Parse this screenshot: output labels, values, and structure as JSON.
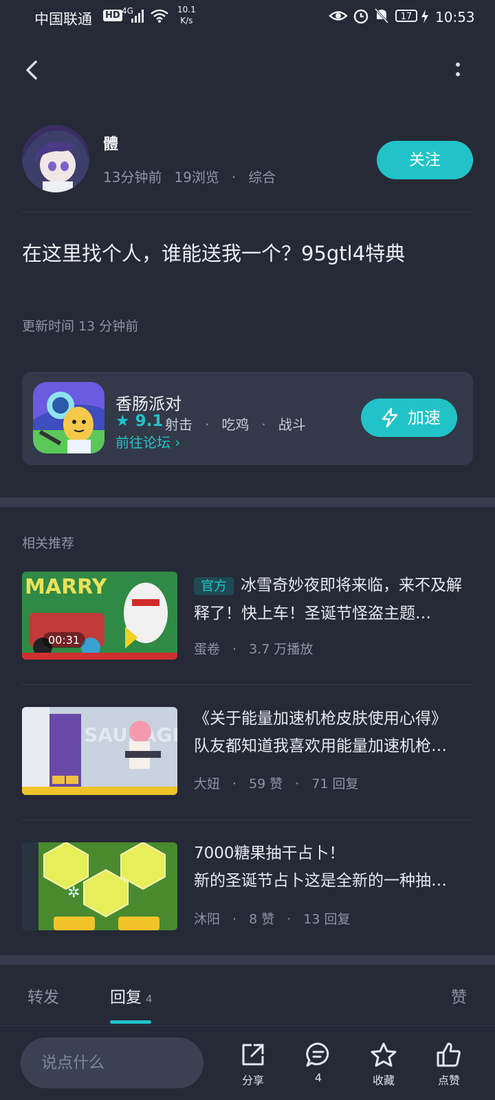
{
  "status_bar": {
    "carrier": "中国联通",
    "hd": "HD",
    "network": "4G",
    "speed_value": "10.1",
    "speed_unit": "K/s",
    "battery": "17",
    "time": "10:53"
  },
  "post": {
    "author": "體",
    "time_ago": "13分钟前",
    "views": "19浏览",
    "category": "综合",
    "follow_label": "关注",
    "text": "在这里找个人，谁能送我一个？95gtl4特典",
    "update_time": "更新时间 13 分钟前"
  },
  "game_card": {
    "name": "香肠派对",
    "rating": "9.1",
    "tags": [
      "射击",
      "吃鸡",
      "战斗"
    ],
    "forum_link": "前往论坛",
    "speed_label": "加速"
  },
  "related": {
    "title": "相关推荐",
    "items": [
      {
        "tag": "官方",
        "title": "冰雪奇妙夜即将来临，来不及解释了！快上车！圣诞节怪盗主题…",
        "duration": "00:31",
        "author": "蛋卷",
        "stat1": "3.7 万播放",
        "stat2": ""
      },
      {
        "tag": "",
        "title": "《关于能量加速机枪皮肤使用心得》",
        "subtitle": "队友都知道我喜欢用能量加速机枪…",
        "author": "大妞",
        "stat1": "59 赞",
        "stat2": "71 回复"
      },
      {
        "tag": "",
        "title": "7000糖果抽干占卜！",
        "subtitle": "新的圣诞节占卜这是全新的一种抽…",
        "author": "沐阳",
        "stat1": "8 赞",
        "stat2": "13 回复"
      }
    ]
  },
  "tabs": {
    "forward": "转发",
    "reply": "回复",
    "reply_count": "4",
    "like": "赞"
  },
  "bottom_bar": {
    "input_placeholder": "说点什么",
    "share": "分享",
    "comment_count": "4",
    "favorite": "收藏",
    "like": "点赞"
  },
  "colors": {
    "background": "#262a37",
    "accent": "#21c3c8",
    "card": "#333948"
  }
}
